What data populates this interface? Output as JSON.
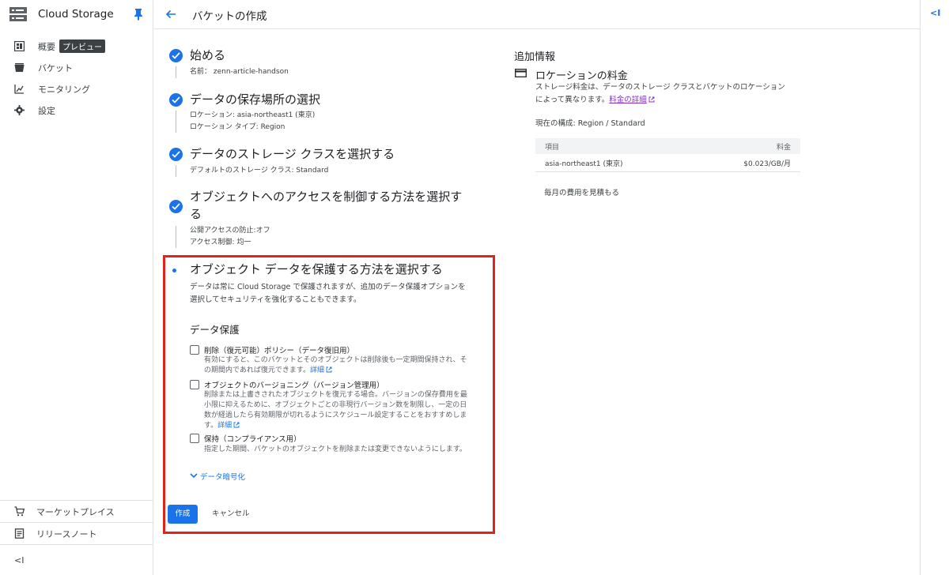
{
  "sidebar": {
    "brand": "Cloud Storage",
    "items": [
      {
        "label": "概要",
        "badge": "プレビュー",
        "icon": "dashboard-icon"
      },
      {
        "label": "バケット",
        "icon": "bucket-icon"
      },
      {
        "label": "モニタリング",
        "icon": "chart-icon"
      },
      {
        "label": "設定",
        "icon": "gear-icon"
      }
    ],
    "bottom": [
      {
        "label": "マーケットプレイス",
        "icon": "cart-icon"
      },
      {
        "label": "リリースノート",
        "icon": "notes-icon"
      }
    ],
    "collapse": "<I"
  },
  "header": {
    "title": "バケットの作成"
  },
  "right_edge": {
    "toggle": "<I"
  },
  "steps": [
    {
      "title": "始める",
      "details": [
        "名前： zenn-article-handson"
      ]
    },
    {
      "title": "データの保存場所の選択",
      "details": [
        "ロケーション: asia-northeast1 (東京)",
        "ロケーション タイプ: Region"
      ]
    },
    {
      "title": "データのストレージ クラスを選択する",
      "details": [
        "デフォルトのストレージ クラス: Standard"
      ]
    },
    {
      "title_line1": "オブジェクトへのアクセスを制御する方法を選択す",
      "title_line2": "る",
      "details": [
        "公開アクセスの防止:オフ",
        "アクセス制御: 均一"
      ]
    }
  ],
  "protect": {
    "title": "オブジェクト データを保護する方法を選択する",
    "desc_line1": "データは常に Cloud Storage で保護されますが、追加のデータ保護オプションを",
    "desc_line2": "選択してセキュリティを強化することもできます。",
    "section": "データ保護",
    "options": [
      {
        "label": "削除（復元可能）ポリシー（データ復旧用）",
        "lines": [
          "有効にすると、このバケットとそのオブジェクトは削除後も一定期間保持され、そ",
          "の期間内であれば復元できます。"
        ],
        "link": "詳細",
        "checked": false
      },
      {
        "label": "オブジェクトのバージョニング（バージョン管理用）",
        "lines": [
          "削除または上書きされたオブジェクトを復元する場合。バージョンの保存費用を最",
          "小限に抑えるために、オブジェクトごとの非現行バージョン数を制限し、一定の日",
          "数が経過したら有効期限が切れるようにスケジュール設定することをおすすめしま",
          "す。"
        ],
        "link": "詳細",
        "checked": false
      },
      {
        "label": "保持（コンプライアンス用）",
        "lines": [
          "指定した期間、バケットのオブジェクトを削除または変更できないようにします。"
        ],
        "checked": false
      }
    ],
    "expander": "データ暗号化",
    "create": "作成",
    "cancel": "キャンセル"
  },
  "info": {
    "title": "追加情報",
    "location_title": "ロケーションの料金",
    "desc_line1": "ストレージ料金は、データのストレージ クラスとバケットのロケーション",
    "desc_line2": "によって異なります。",
    "link": "料金の詳細",
    "current": "現在の構成: Region / Standard",
    "table": {
      "headers": [
        "項目",
        "料金"
      ],
      "rows": [
        [
          "asia-northeast1 (東京)",
          "$0.023/GB/月"
        ]
      ]
    },
    "estimate": "毎月の費用を見積もる"
  },
  "colors": {
    "accent": "#1a73e8",
    "highlight": "#e0241b"
  }
}
